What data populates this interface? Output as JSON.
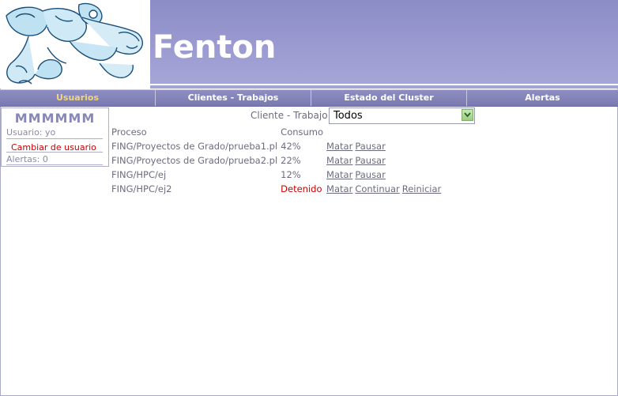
{
  "header": {
    "brand": "Fenton"
  },
  "nav": {
    "items": [
      {
        "label": "Usuarios"
      },
      {
        "label": "Clientes - Trabajos"
      },
      {
        "label": "Estado del Cluster"
      },
      {
        "label": "Alertas"
      }
    ],
    "active_color": "#f1d57a"
  },
  "user_panel": {
    "name": "MMMMMM",
    "user_line": "Usuario: yo",
    "change_user": "Cambiar de usuario",
    "alerts_line": "Alertas: 0"
  },
  "filter": {
    "label": "Cliente - Trabajo:",
    "selected": "Todos"
  },
  "table": {
    "headers": {
      "process": "Proceso",
      "consumption": "Consumo"
    },
    "rows": [
      {
        "process": "FING/Proyectos de Grado/prueba1.pl",
        "consumption": "42%",
        "actions": [
          "Matar",
          "Pausar"
        ]
      },
      {
        "process": "FING/Proyectos de Grado/prueba2.pl",
        "consumption": "22%",
        "actions": [
          "Matar",
          "Pausar"
        ]
      },
      {
        "process": "FING/HPC/ej",
        "consumption": "12%",
        "actions": [
          "Matar",
          "Pausar"
        ]
      },
      {
        "process": "FING/HPC/ej2",
        "consumption": "Detenido",
        "actions": [
          "Matar",
          "Continuar",
          "Reiniciar"
        ]
      }
    ]
  },
  "colors": {
    "banner": "#9c9cd2",
    "nav": "#8484ba",
    "stopped": "#cc0000",
    "text": "#6c6c80"
  }
}
